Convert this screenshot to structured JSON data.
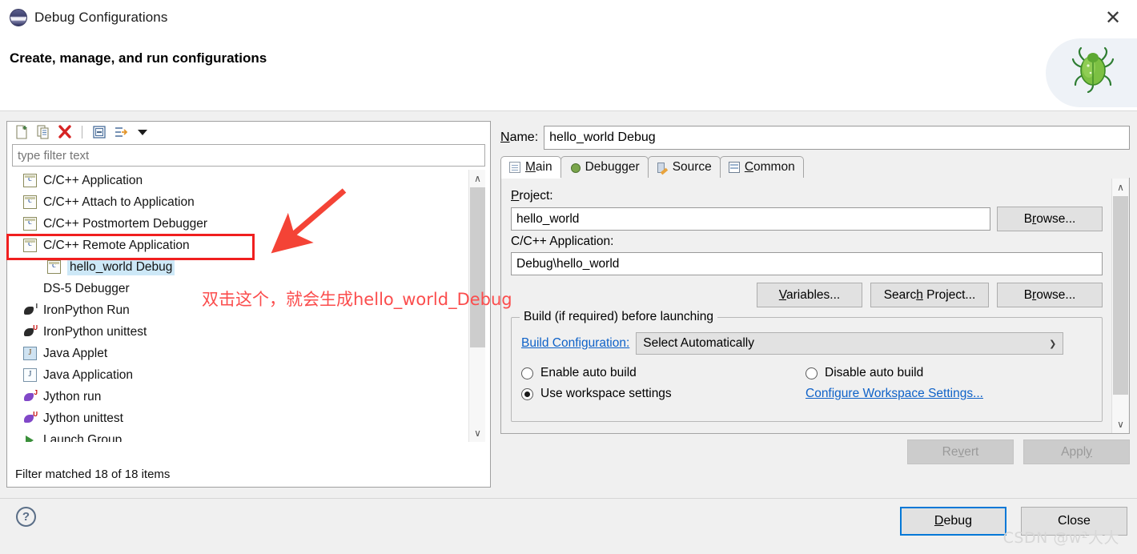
{
  "window": {
    "title": "Debug Configurations",
    "icon": "eclipse-sphere-icon",
    "close_label": "✕"
  },
  "banner": {
    "heading": "Create, manage, and run configurations",
    "art_icon": "green-bug-icon"
  },
  "left_panel": {
    "toolbar": [
      {
        "name": "new-launch-configuration-icon",
        "label": "New launch configuration"
      },
      {
        "name": "duplicate-icon",
        "label": "Duplicate"
      },
      {
        "name": "delete-icon",
        "label": "Delete"
      },
      {
        "name": "collapse-all-icon",
        "label": "Collapse All"
      },
      {
        "name": "filter-icon",
        "label": "Filter launch configurations"
      },
      {
        "name": "view-menu-chevron-down-icon",
        "label": "View Menu"
      }
    ],
    "filter": {
      "value": "",
      "placeholder": "type filter text"
    },
    "tree": [
      {
        "label": "C/C++ Application",
        "icon": "c-app-icon",
        "indent": 0,
        "expander": "",
        "selected": false
      },
      {
        "label": "C/C++ Attach to Application",
        "icon": "c-app-icon",
        "indent": 0,
        "expander": "",
        "selected": false
      },
      {
        "label": "C/C++ Postmortem Debugger",
        "icon": "c-app-icon",
        "indent": 0,
        "expander": "",
        "selected": false
      },
      {
        "label": "C/C++ Remote Application",
        "icon": "c-app-icon",
        "indent": 0,
        "expander": "⌄",
        "selected": false
      },
      {
        "label": "hello_world Debug",
        "icon": "c-app-icon",
        "indent": 1,
        "expander": "",
        "selected": true
      },
      {
        "label": "DS-5 Debugger",
        "icon": "ds5-bug-icon",
        "indent": 0,
        "expander": "",
        "selected": false
      },
      {
        "label": "IronPython Run",
        "icon": "ironpython-run-icon",
        "indent": 0,
        "expander": "",
        "selected": false
      },
      {
        "label": "IronPython unittest",
        "icon": "ironpython-unittest-icon",
        "indent": 0,
        "expander": "",
        "selected": false
      },
      {
        "label": "Java Applet",
        "icon": "java-applet-icon",
        "indent": 0,
        "expander": "",
        "selected": false
      },
      {
        "label": "Java Application",
        "icon": "java-application-icon",
        "indent": 0,
        "expander": "",
        "selected": false
      },
      {
        "label": "Jython run",
        "icon": "jython-run-icon",
        "indent": 0,
        "expander": "",
        "selected": false
      },
      {
        "label": "Jython unittest",
        "icon": "jython-unittest-icon",
        "indent": 0,
        "expander": "",
        "selected": false
      },
      {
        "label": "Launch Group",
        "icon": "launch-group-icon",
        "indent": 0,
        "expander": "",
        "selected": false
      }
    ],
    "status": "Filter matched 18 of 18 items",
    "scrollbar": {
      "up": "∧",
      "down": "∨"
    }
  },
  "right_panel": {
    "name_label": "Name:",
    "name_mnemonic": "N",
    "name_value": "hello_world Debug",
    "tabs": [
      {
        "label": "Main",
        "mnemonic": "M",
        "icon": "document-icon",
        "active": true
      },
      {
        "label": "Debugger",
        "mnemonic": "",
        "icon": "debugger-bug-icon",
        "active": false
      },
      {
        "label": "Source",
        "mnemonic": "",
        "icon": "source-edit-icon",
        "active": false
      },
      {
        "label": "Common",
        "mnemonic": "C",
        "icon": "common-table-icon",
        "active": false
      }
    ],
    "main_tab": {
      "project_label": "Project:",
      "project_value": "hello_world",
      "project_browse": "Browse...",
      "application_label": "C/C++ Application:",
      "application_value": "Debug\\hello_world",
      "variables_button": "Variables...",
      "search_project_button": "Search Project...",
      "browse_button": "Browse...",
      "build_group_title": "Build (if required) before launching",
      "build_config_link": "Build Configuration:",
      "build_config_value": "Select Automatically",
      "radio_enable_auto_build": "Enable auto build",
      "radio_disable_auto_build": "Disable auto build",
      "radio_use_workspace_settings": "Use workspace settings",
      "configure_workspace_link": "Configure Workspace Settings...",
      "selected_radio": "Use workspace settings"
    },
    "revert_button": "Revert",
    "apply_button": "Apply",
    "scrollbar": {
      "up": "∧",
      "down": "∨"
    }
  },
  "footer": {
    "help_icon": "help-question-icon",
    "help_glyph": "?",
    "debug_button": "Debug",
    "debug_mnemonic": "D",
    "close_button": "Close",
    "watermark": "CSDN @w²大大"
  },
  "annotations": {
    "text": "双击这个，就会生成hello_world_Debug",
    "color": "#fb4d4d",
    "box_target": "C/C++ Remote Application",
    "arrow": "red-arrow-pointing-down-left"
  },
  "colors": {
    "accent": "#0078d7",
    "link": "#0f62c8",
    "annotation": "#f01f1f",
    "selection": "#cde8f7",
    "dialog_bg": "#f0f0f0"
  }
}
